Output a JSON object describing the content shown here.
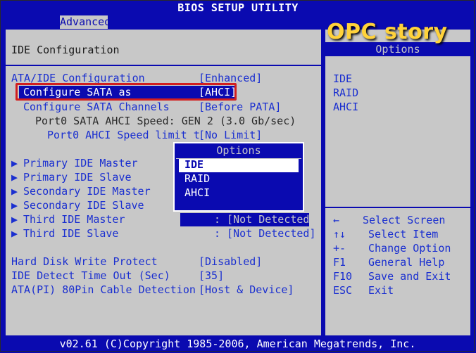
{
  "window": {
    "title": "BIOS SETUP UTILITY"
  },
  "tabs": [
    {
      "label": "Advanced"
    }
  ],
  "watermark": "OPC story",
  "left": {
    "title": "IDE Configuration",
    "rows": [
      {
        "label": "ATA/IDE Configuration",
        "value": "[Enhanced]"
      },
      {
        "label": "Configure SATA as",
        "value": "[AHCI]"
      },
      {
        "label": "Configure SATA Channels",
        "value": "[Before PATA]"
      },
      {
        "label": "Port0 SATA AHCI Speed: GEN 2 (3.0 Gb/sec)"
      },
      {
        "label": "Port0 AHCI Speed limit t",
        "value": "[No Limit]"
      }
    ],
    "devices": [
      {
        "label": "Primary IDE Master",
        "value": ""
      },
      {
        "label": "Primary IDE Slave",
        "value": ""
      },
      {
        "label": "Secondary IDE Master",
        "value": ""
      },
      {
        "label": "Secondary IDE Slave",
        "value": ""
      },
      {
        "label": "Third IDE Master",
        "value": ": [Not Detected]"
      },
      {
        "label": "Third IDE Slave",
        "value": ": [Not Detected]"
      }
    ],
    "arrow": "▶",
    "settings": [
      {
        "label": "Hard Disk Write Protect",
        "value": "[Disabled]"
      },
      {
        "label": "IDE Detect Time Out (Sec)",
        "value": "[35]"
      },
      {
        "label": "ATA(PI) 80Pin Cable Detection",
        "value": "[Host & Device]"
      }
    ]
  },
  "right": {
    "header": "Options",
    "options": [
      "IDE",
      "RAID",
      "AHCI"
    ],
    "help": [
      {
        "key": "←",
        "desc": "Select Screen"
      },
      {
        "key": "↑↓",
        "desc": "Select Item"
      },
      {
        "key": "+-",
        "desc": "Change Option"
      },
      {
        "key": "F1",
        "desc": "General Help"
      },
      {
        "key": "F10",
        "desc": "Save and Exit"
      },
      {
        "key": "ESC",
        "desc": "Exit"
      }
    ]
  },
  "popup": {
    "title": "Options",
    "items": [
      "IDE",
      "RAID",
      "AHCI"
    ],
    "selected": "IDE"
  },
  "footer": "v02.61 (C)Copyright 1985-2006, American Megatrends, Inc.",
  "colors": {
    "blue": "#0a0ab0",
    "gray": "#c8c8c8",
    "highlight_box": "#d21e1e",
    "watermark": "#ffd23a"
  }
}
